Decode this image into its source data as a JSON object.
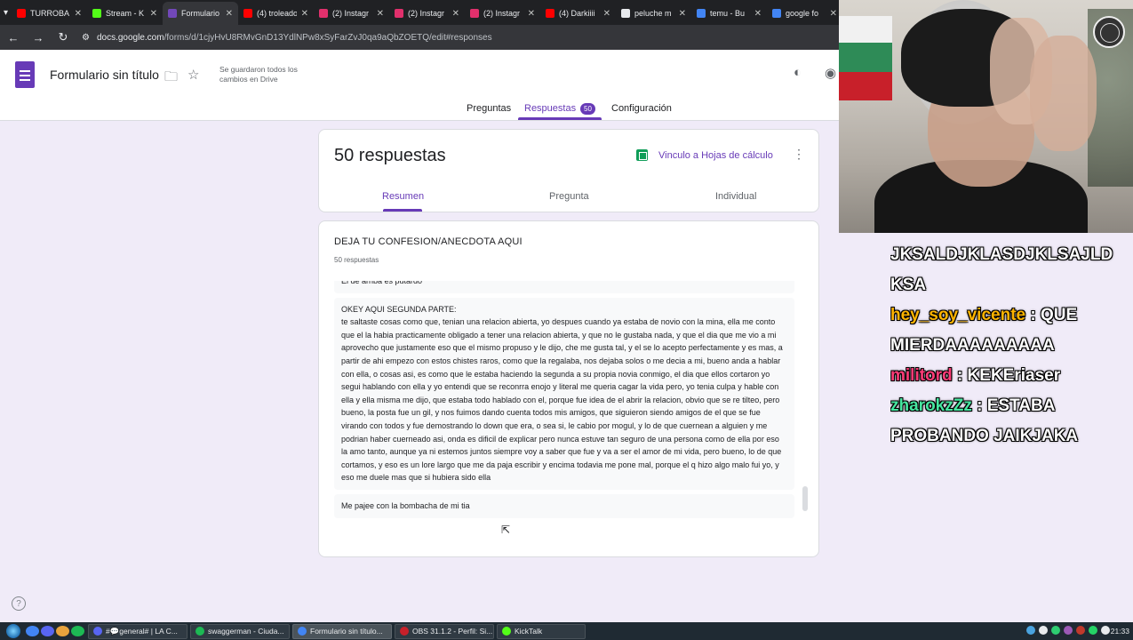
{
  "browser": {
    "tabs": [
      {
        "label": "TURROBA",
        "favicon_color": "#ff0000",
        "active": false
      },
      {
        "label": "Stream - K",
        "favicon_color": "#53fc18",
        "active": false
      },
      {
        "label": "Formulario",
        "favicon_color": "#7248b9",
        "active": true
      },
      {
        "label": "(4) troleado",
        "favicon_color": "#ff0000",
        "active": false
      },
      {
        "label": "(2) Instagr",
        "favicon_color": "#e1306c",
        "active": false
      },
      {
        "label": "(2) Instagr",
        "favicon_color": "#e1306c",
        "active": false
      },
      {
        "label": "(2) Instagr",
        "favicon_color": "#e1306c",
        "active": false
      },
      {
        "label": "(4) Darkiiii",
        "favicon_color": "#ff0000",
        "active": false
      },
      {
        "label": "peluche m",
        "favicon_color": "#e8eaed",
        "active": false
      },
      {
        "label": "temu - Bu",
        "favicon_color": "#4285f4",
        "active": false
      },
      {
        "label": "google fo",
        "favicon_color": "#4285f4",
        "active": false
      }
    ],
    "url_host": "docs.google.com",
    "url_path": "/forms/d/1cjyHvU8RMvGnD13YdlNPw8xSyFarZvJ0qa9aQbZOETQ/edit#responses"
  },
  "forms_header": {
    "title": "Formulario sin título",
    "save_status": "Se guardaron todos los cambios en Drive",
    "tabs": [
      {
        "label": "Preguntas",
        "active": false
      },
      {
        "label": "Respuestas",
        "active": true
      },
      {
        "label": "Configuración",
        "active": false
      }
    ],
    "responses_badge": "50"
  },
  "summary": {
    "count_label": "50 respuestas",
    "sheets_link": "Vinculo a Hojas de cálculo",
    "subtabs": [
      {
        "label": "Resumen",
        "active": true
      },
      {
        "label": "Pregunta",
        "active": false
      },
      {
        "label": "Individual",
        "active": false
      }
    ]
  },
  "question": {
    "title": "DEJA TU CONFESION/ANECDOTA AQUI",
    "count": "50 respuestas",
    "answers": [
      "El de arriba es putardo",
      "OKEY AQUI SEGUNDA PARTE:\nte saltaste cosas como que, tenian una relacion abierta, yo despues cuando ya estaba de novio con la mina, ella me conto que el la habia practicamente obligado a tener una relacion abierta, y que no le gustaba nada, y que el dia que me vio a mi aprovecho que justamente eso que el mismo propuso y le dijo, che me gusta tal, y el se lo acepto perfectamente y es mas, a partir de ahi empezo con estos chistes raros, como que la regalaba, nos dejaba solos o me decia a mi, bueno anda a hablar con ella, o cosas asi, es como que le estaba haciendo la segunda a su propia novia conmigo, el dia que ellos cortaron yo segui hablando con ella y yo entendi que se reconrra enojo y literal me queria cagar la vida pero, yo tenia culpa y hable con ella y ella misma me dijo, que estaba todo hablado con el, porque fue idea de el abrir la relacion, obvio que se re tilteo, pero bueno, la posta fue un gil, y nos fuimos dando cuenta todos mis amigos, que siguieron siendo amigos de el que se fue virando con todos y fue demostrando lo down que era, o sea si, le cabio por mogul, y lo de que cuernean a alguien y me podrian haber cuerneado asi, onda es dificil de explicar pero nunca estuve tan seguro de una persona como de ella por eso la amo tanto, aunque ya ni estemos juntos siempre voy a saber que fue y va a ser el amor de mi vida, pero bueno, lo de que cortamos, y eso es un lore largo que me da paja escribir y encima todavia me pone mal, porque el q hizo algo malo fui yo, y eso me duele mas que si hubiera sido ella",
      "Me pajee con la bombacha de mi tia"
    ]
  },
  "chat": {
    "messages": [
      {
        "user": "",
        "user_color": "#ffffff",
        "text": "JKSALDJKLASDJKLSAJLD KSA"
      },
      {
        "user": "hey_soy_vicente",
        "user_color": "#ffb400",
        "text": ": QUE MIERDAAAAAAAAA"
      },
      {
        "user": "militord",
        "user_color": "#ff3c78",
        "text": ": KEKEriaser"
      },
      {
        "user": "zharokzZz",
        "user_color": "#46e6a0",
        "text": ": ESTABA PROBANDO JAIKJAKA"
      }
    ]
  },
  "taskbar": {
    "items": [
      {
        "label": "#💬general# | LA C...",
        "icon_color": "#5865f2",
        "active": false
      },
      {
        "label": "swaggerman - Ciuda...",
        "icon_color": "#1db954",
        "active": false
      },
      {
        "label": "Formulario sin título...",
        "icon_color": "#4285f4",
        "active": true
      },
      {
        "label": "OBS 31.1.2 - Perfil: Si...",
        "icon_color": "#c8202a",
        "active": false
      },
      {
        "label": "KickTalk",
        "icon_color": "#53fc18",
        "active": false
      }
    ],
    "clock": "21:33"
  }
}
